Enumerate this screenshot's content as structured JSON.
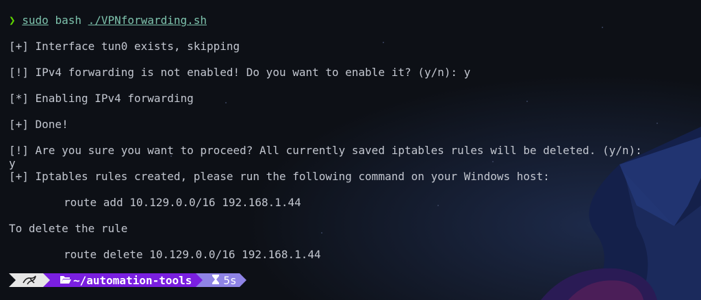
{
  "prompt": {
    "arrow": "❯",
    "cmd_sudo": "sudo",
    "cmd_bash": "bash",
    "cmd_script": "./VPNforwarding.sh"
  },
  "output": {
    "l1": "[+] Interface tun0 exists, skipping",
    "l2": "[!] IPv4 forwarding is not enabled! Do you want to enable it? (y/n): y",
    "l3": "[*] Enabling IPv4 forwarding",
    "l4": "[+] Done!",
    "l5": "[!] Are you sure you want to proceed? All currently saved iptables rules will be deleted. (y/n):",
    "l6": "y",
    "l7": "[+] Iptables rules created, please run the following command on your Windows host:",
    "l8": "route add 10.129.0.0/16 192.168.1.44",
    "l9": "To delete the rule",
    "l10": "route delete 10.129.0.0/16 192.168.1.44"
  },
  "status_bar": {
    "logo_icon": "kali-dragon-icon",
    "folder_icon": "folder-open-icon",
    "path": "~/automation-tools",
    "timer_icon": "hourglass-icon",
    "duration": "5s",
    "colors": {
      "logo_bg": "#e6e6e6",
      "path_bg": "#7a1fe0",
      "time_bg": "#8f84e6"
    }
  },
  "colors": {
    "background": "#0d1016",
    "text": "#c3c7d0",
    "prompt_arrow": "#5fd700",
    "command": "#7ec3ad"
  }
}
